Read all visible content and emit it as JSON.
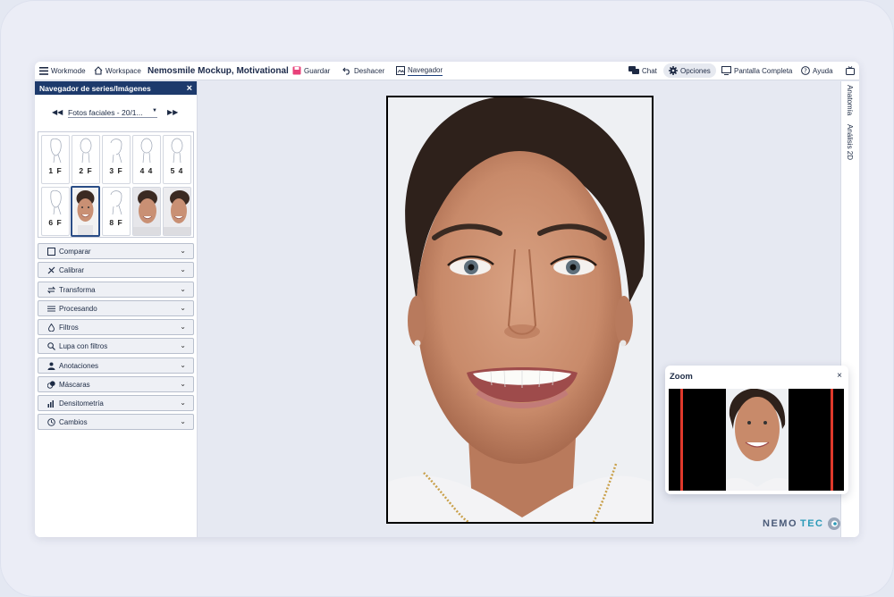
{
  "toolbar": {
    "workmode": "Workmode",
    "workspace": "Workspace",
    "title": "Nemosmile Mockup, Motivational",
    "guardar": "Guardar",
    "deshacer": "Deshacer",
    "navegador": "Navegador",
    "chat": "Chat",
    "opciones": "Opciones",
    "pantalla_completa": "Pantalla Completa",
    "ayuda": "Ayuda"
  },
  "left_panel": {
    "header": "Navegador de series/Imágenes",
    "close": "×",
    "series_select": "Fotos faciales - 20/1...",
    "thumbnails": [
      {
        "label": "1 F"
      },
      {
        "label": "2 F"
      },
      {
        "label": "3 F"
      },
      {
        "label": "4 4"
      },
      {
        "label": "5 4"
      },
      {
        "label": "6 F"
      },
      {
        "label": ""
      },
      {
        "label": "8 F"
      },
      {
        "label": ""
      },
      {
        "label": ""
      }
    ],
    "accordion": [
      {
        "label": "Comparar",
        "icon": "square-icon"
      },
      {
        "label": "Calibrar",
        "icon": "ruler-icon"
      },
      {
        "label": "Transforma",
        "icon": "transform-icon"
      },
      {
        "label": "Procesando",
        "icon": "sliders-icon"
      },
      {
        "label": "Filtros",
        "icon": "drop-icon"
      },
      {
        "label": "Lupa con filtros",
        "icon": "magnifier-icon"
      },
      {
        "label": "Anotaciones",
        "icon": "person-icon"
      },
      {
        "label": "Máscaras",
        "icon": "mask-icon"
      },
      {
        "label": "Densitometría",
        "icon": "chart-icon"
      },
      {
        "label": "Cambios",
        "icon": "history-icon"
      }
    ]
  },
  "right_rail": {
    "tab1": "Anatomía",
    "tab2": "Análisis 2D"
  },
  "zoom": {
    "title": "Zoom",
    "close": "×"
  },
  "logo": {
    "part1": "NEMO",
    "part2": "TEC"
  },
  "colors": {
    "header_navy": "#1d3a6c",
    "accent_red": "#e0392b",
    "logo_teal": "#2a9ab8"
  }
}
